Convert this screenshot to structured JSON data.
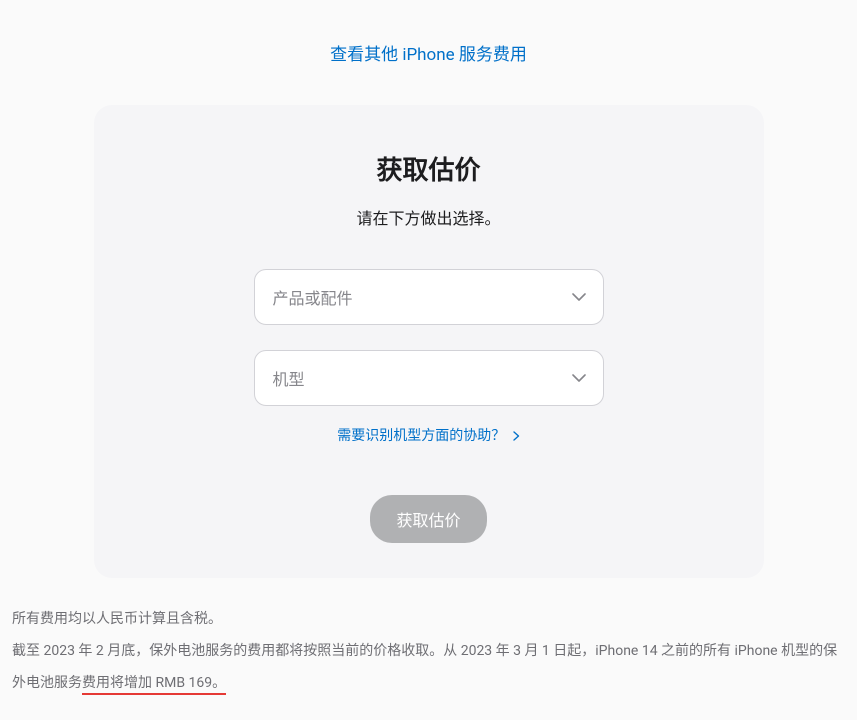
{
  "topLink": "查看其他 iPhone 服务费用",
  "card": {
    "title": "获取估价",
    "subtitle": "请在下方做出选择。",
    "select1_placeholder": "产品或配件",
    "select2_placeholder": "机型",
    "help_link": "需要识别机型方面的协助？",
    "submit_label": "获取估价"
  },
  "footer": {
    "line1": "所有费用均以人民币计算且含税。",
    "line2_prefix": "截至 2023 年 2 月底，保外电池服务的费用都将按照当前的价格收取。从 2023 年 3 月 1 日起，iPhone 14 之前的所有 iPhone 机型的保外电池服务",
    "line2_highlight": "费用将增加 RMB 169。"
  }
}
